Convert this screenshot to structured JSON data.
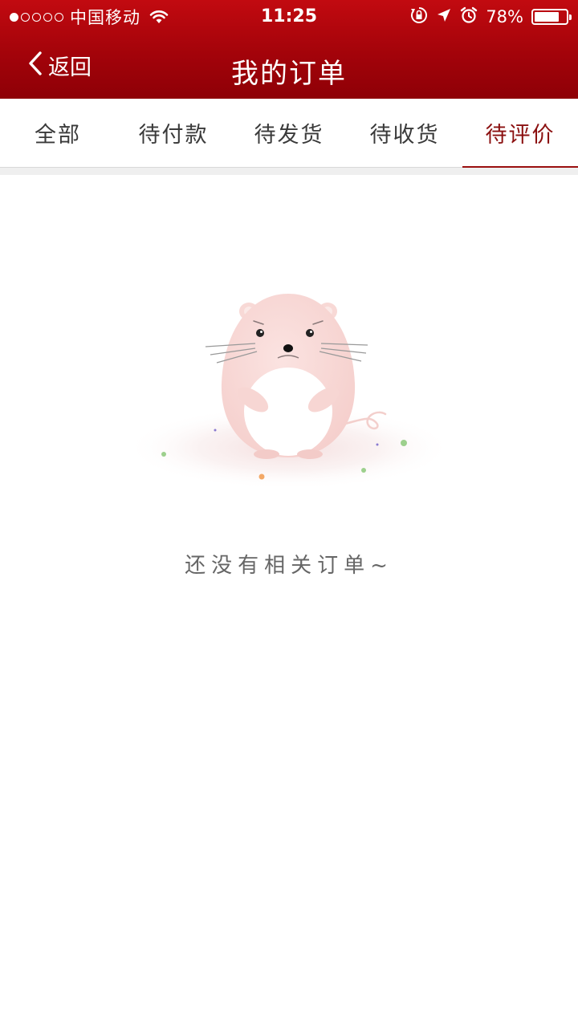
{
  "status_bar": {
    "carrier": "中国移动",
    "time": "11:25",
    "battery_percent": "78%",
    "battery_level": 0.78,
    "signal_bars": 1
  },
  "nav": {
    "back_label": "返回",
    "title": "我的订单"
  },
  "tabs": [
    {
      "label": "全部",
      "active": false
    },
    {
      "label": "待付款",
      "active": false
    },
    {
      "label": "待发货",
      "active": false
    },
    {
      "label": "待收货",
      "active": false
    },
    {
      "label": "待评价",
      "active": true
    }
  ],
  "empty_state": {
    "message": "还没有相关订单~",
    "illustration": "sad-mouse-illustration"
  },
  "colors": {
    "header_red": "#a3030a",
    "active_tab": "#8b1010",
    "text_gray": "#666666"
  }
}
